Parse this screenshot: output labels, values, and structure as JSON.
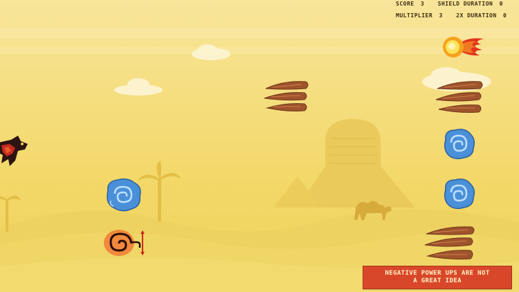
{
  "hud": {
    "score_label": "SCORE",
    "score_value": "3",
    "shield_label": "SHIELD DURATION",
    "shield_value": "0",
    "multiplier_label": "MULTIPLIER",
    "multiplier_value": "3",
    "double_label": "2X DURATION",
    "double_value": "0"
  },
  "tip": {
    "line1": "NEGATIVE POWER UPS ARE NOT",
    "line2": "A GREAT IDEA"
  },
  "colors": {
    "sky": "#f5dc6e",
    "dune": "#eccf5c",
    "tip_bg": "#d9472b",
    "tip_text": "#fff3c4",
    "shield_orb": "#4a90d9",
    "spike": "#a0542c"
  },
  "icons": {
    "player": "dragon-icon",
    "fireball": "fireball-icon",
    "feather": "feather-spike-icon",
    "shield": "blue-swirl-shield-icon",
    "slow": "red-spiral-slow-icon"
  }
}
